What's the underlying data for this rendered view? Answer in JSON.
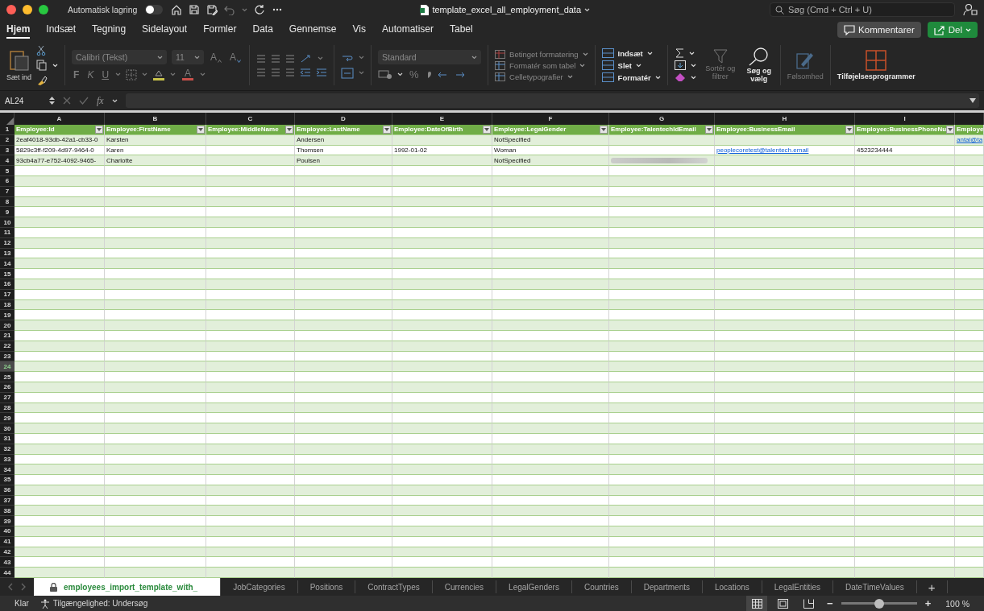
{
  "title_bar": {
    "autosave_label": "Automatisk lagring",
    "autosave_on": false,
    "filename": "template_excel_all_employment_data",
    "search_placeholder": "Søg (Cmd + Ctrl + U)"
  },
  "menu_tabs": [
    {
      "label": "Hjem",
      "selected": true
    },
    {
      "label": "Indsæt",
      "selected": false
    },
    {
      "label": "Tegning",
      "selected": false
    },
    {
      "label": "Sidelayout",
      "selected": false
    },
    {
      "label": "Formler",
      "selected": false
    },
    {
      "label": "Data",
      "selected": false
    },
    {
      "label": "Gennemse",
      "selected": false
    },
    {
      "label": "Vis",
      "selected": false
    },
    {
      "label": "Automatiser",
      "selected": false
    },
    {
      "label": "Tabel",
      "selected": false
    }
  ],
  "comments_button": "Kommentarer",
  "share_button": "Del",
  "ribbon": {
    "paste_label": "Sæt ind",
    "font_name": "Calibri (Tekst)",
    "font_size": "11",
    "grow_font": "A",
    "shrink_font": "A",
    "bold": "F",
    "italic": "K",
    "underline": "U",
    "font_color_letter": "A",
    "number_format": "Standard",
    "percent": "%",
    "styles": [
      "Betinget formatering",
      "Formatér som tabel",
      "Celletypografier"
    ],
    "cells": [
      "Indsæt",
      "Slet",
      "Formatér"
    ],
    "sort_label": "Sortér og filtrer",
    "find_label": "Søg og vælg",
    "sensitivity": "Følsomhed",
    "addins": "Tilføjelsesprogrammer"
  },
  "formula_bar": {
    "name_box": "AL24",
    "fx": "fx"
  },
  "columns": [
    "A",
    "B",
    "C",
    "D",
    "E",
    "F",
    "G",
    "H",
    "I"
  ],
  "header_row": [
    "Employee:Id",
    "Employee:FirstName",
    "Employee:MiddleName",
    "Employee:LastName",
    "Employee:DateOfBirth",
    "Employee:LegalGender",
    "Employee:TalentechIdEmail",
    "Employee:BusinessEmail",
    "Employee:BusinessPhoneNu",
    "Employe"
  ],
  "rows": [
    [
      "2eaf4018-93db-42a1-cb33-0",
      "Karsten",
      null,
      "Andersen",
      null,
      "NotSpecified",
      null,
      null,
      null,
      {
        "text": "antal@ta",
        "kind": "link"
      }
    ],
    [
      "5829c3ff-f209-4d97-9464-0",
      "Karen",
      null,
      "Thomsen",
      "1992-01-02",
      "Woman",
      null,
      {
        "text": "peoplecoretest@talentech.email",
        "kind": "link"
      },
      "4523234444",
      null
    ],
    [
      "93cb4a77-e752-4092-9465-",
      "Charlotte",
      null,
      "Poulsen",
      null,
      "NotSpecified",
      {
        "kind": "redacted"
      },
      null,
      null,
      null
    ]
  ],
  "row_headers": [
    {
      "label": "1",
      "selected": false
    },
    {
      "label": "2",
      "selected": false
    },
    {
      "label": "3",
      "selected": false
    },
    {
      "label": "4",
      "selected": false
    },
    {
      "label": "5",
      "selected": false
    },
    {
      "label": "6",
      "selected": false
    },
    {
      "label": "7",
      "selected": false
    },
    {
      "label": "8",
      "selected": false
    },
    {
      "label": "9",
      "selected": false
    },
    {
      "label": "10",
      "selected": false
    },
    {
      "label": "11",
      "selected": false
    },
    {
      "label": "12",
      "selected": false
    },
    {
      "label": "13",
      "selected": false
    },
    {
      "label": "14",
      "selected": false
    },
    {
      "label": "15",
      "selected": false
    },
    {
      "label": "16",
      "selected": false
    },
    {
      "label": "17",
      "selected": false
    },
    {
      "label": "18",
      "selected": false
    },
    {
      "label": "19",
      "selected": false
    },
    {
      "label": "20",
      "selected": false
    },
    {
      "label": "21",
      "selected": false
    },
    {
      "label": "22",
      "selected": false
    },
    {
      "label": "23",
      "selected": false
    },
    {
      "label": "24",
      "selected": true
    },
    {
      "label": "25",
      "selected": false
    },
    {
      "label": "26",
      "selected": false
    },
    {
      "label": "27",
      "selected": false
    },
    {
      "label": "28",
      "selected": false
    },
    {
      "label": "29",
      "selected": false
    },
    {
      "label": "30",
      "selected": false
    },
    {
      "label": "31",
      "selected": false
    },
    {
      "label": "32",
      "selected": false
    },
    {
      "label": "33",
      "selected": false
    },
    {
      "label": "34",
      "selected": false
    },
    {
      "label": "35",
      "selected": false
    },
    {
      "label": "36",
      "selected": false
    },
    {
      "label": "37",
      "selected": false
    },
    {
      "label": "38",
      "selected": false
    },
    {
      "label": "39",
      "selected": false
    },
    {
      "label": "40",
      "selected": false
    },
    {
      "label": "41",
      "selected": false
    },
    {
      "label": "42",
      "selected": false
    },
    {
      "label": "43",
      "selected": false
    },
    {
      "label": "44",
      "selected": false
    }
  ],
  "sheet_tabs": [
    {
      "label": "employees_import_template_with_",
      "selected": true,
      "locked": true
    },
    {
      "label": "JobCategories",
      "selected": false,
      "locked": false
    },
    {
      "label": "Positions",
      "selected": false,
      "locked": false
    },
    {
      "label": "ContractTypes",
      "selected": false,
      "locked": false
    },
    {
      "label": "Currencies",
      "selected": false,
      "locked": false
    },
    {
      "label": "LegalGenders",
      "selected": false,
      "locked": false
    },
    {
      "label": "Countries",
      "selected": false,
      "locked": false
    },
    {
      "label": "Departments",
      "selected": false,
      "locked": false
    },
    {
      "label": "Locations",
      "selected": false,
      "locked": false
    },
    {
      "label": "LegalEntities",
      "selected": false,
      "locked": false
    },
    {
      "label": "DateTimeValues",
      "selected": false,
      "locked": false
    }
  ],
  "add_sheet": "+",
  "status_bar": {
    "ready": "Klar",
    "accessibility": "Tilgængelighed: Undersøg",
    "views": [
      {
        "kind": "normal",
        "selected": true
      },
      {
        "kind": "page_layout",
        "selected": false
      },
      {
        "kind": "page_break",
        "selected": false
      }
    ],
    "zoom_out": "−",
    "zoom_in": "+",
    "zoom": {
      "level": 0.5
    },
    "zoom_label": "100 %"
  }
}
